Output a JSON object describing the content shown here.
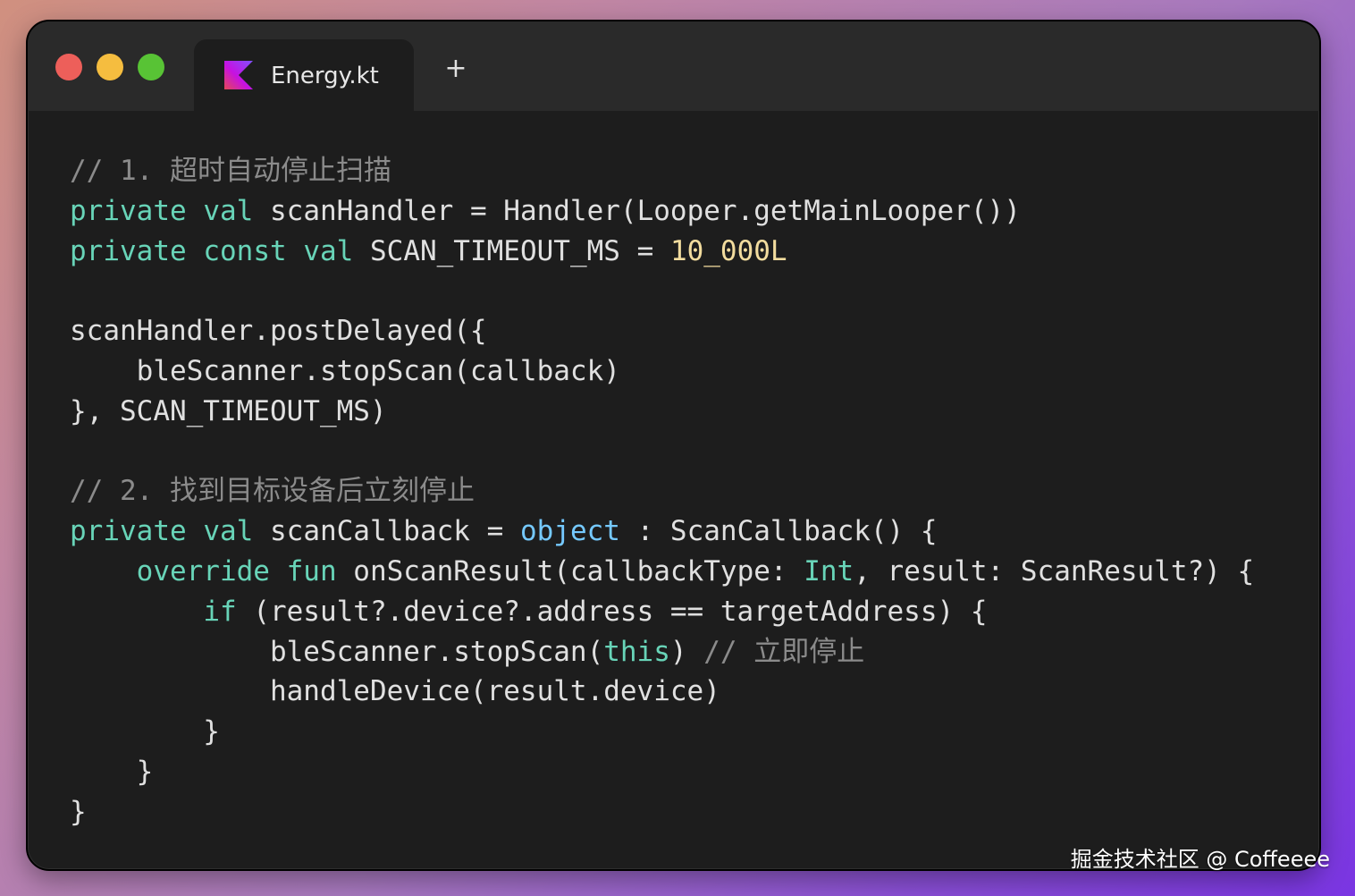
{
  "colors": {
    "keyword": "#68d4b8",
    "identifier": "#e0e0e0",
    "comment": "#8b8b8b",
    "number": "#f2dc9e",
    "accent": "#75c9ff"
  },
  "window": {
    "tab": {
      "icon": "kotlin-icon",
      "label": "Energy.kt"
    },
    "new_tab_label": "+"
  },
  "code_lines": [
    [
      {
        "t": "// 1. 超时自动停止扫描",
        "c": "comment"
      }
    ],
    [
      {
        "t": "private",
        "c": "keyword"
      },
      {
        "t": " "
      },
      {
        "t": "val",
        "c": "keyword"
      },
      {
        "t": " scanHandler = Handler(Looper.getMainLooper())"
      }
    ],
    [
      {
        "t": "private",
        "c": "keyword"
      },
      {
        "t": " "
      },
      {
        "t": "const",
        "c": "keyword"
      },
      {
        "t": " "
      },
      {
        "t": "val",
        "c": "keyword"
      },
      {
        "t": " SCAN_TIMEOUT_MS = "
      },
      {
        "t": "10_000L",
        "c": "number"
      }
    ],
    [],
    [
      {
        "t": "scanHandler.postDelayed({"
      }
    ],
    [
      {
        "t": "    bleScanner.stopScan(callback)"
      }
    ],
    [
      {
        "t": "}, SCAN_TIMEOUT_MS)"
      }
    ],
    [],
    [
      {
        "t": "// 2. 找到目标设备后立刻停止",
        "c": "comment"
      }
    ],
    [
      {
        "t": "private",
        "c": "keyword"
      },
      {
        "t": " "
      },
      {
        "t": "val",
        "c": "keyword"
      },
      {
        "t": " scanCallback = "
      },
      {
        "t": "object",
        "c": "accent"
      },
      {
        "t": " : ScanCallback() {"
      }
    ],
    [
      {
        "t": "    "
      },
      {
        "t": "override",
        "c": "keyword"
      },
      {
        "t": " "
      },
      {
        "t": "fun",
        "c": "keyword"
      },
      {
        "t": " onScanResult(callbackType: "
      },
      {
        "t": "Int",
        "c": "keyword"
      },
      {
        "t": ", result: ScanResult?) {"
      }
    ],
    [
      {
        "t": "        "
      },
      {
        "t": "if",
        "c": "keyword"
      },
      {
        "t": " (result?.device?.address == targetAddress) {"
      }
    ],
    [
      {
        "t": "            bleScanner.stopScan("
      },
      {
        "t": "this",
        "c": "keyword"
      },
      {
        "t": ") "
      },
      {
        "t": "// 立即停止",
        "c": "comment"
      }
    ],
    [
      {
        "t": "            handleDevice(result.device)"
      }
    ],
    [
      {
        "t": "        }"
      }
    ],
    [
      {
        "t": "    }"
      }
    ],
    [
      {
        "t": "}"
      }
    ]
  ],
  "watermark": "掘金技术社区 @ Coffeeee"
}
